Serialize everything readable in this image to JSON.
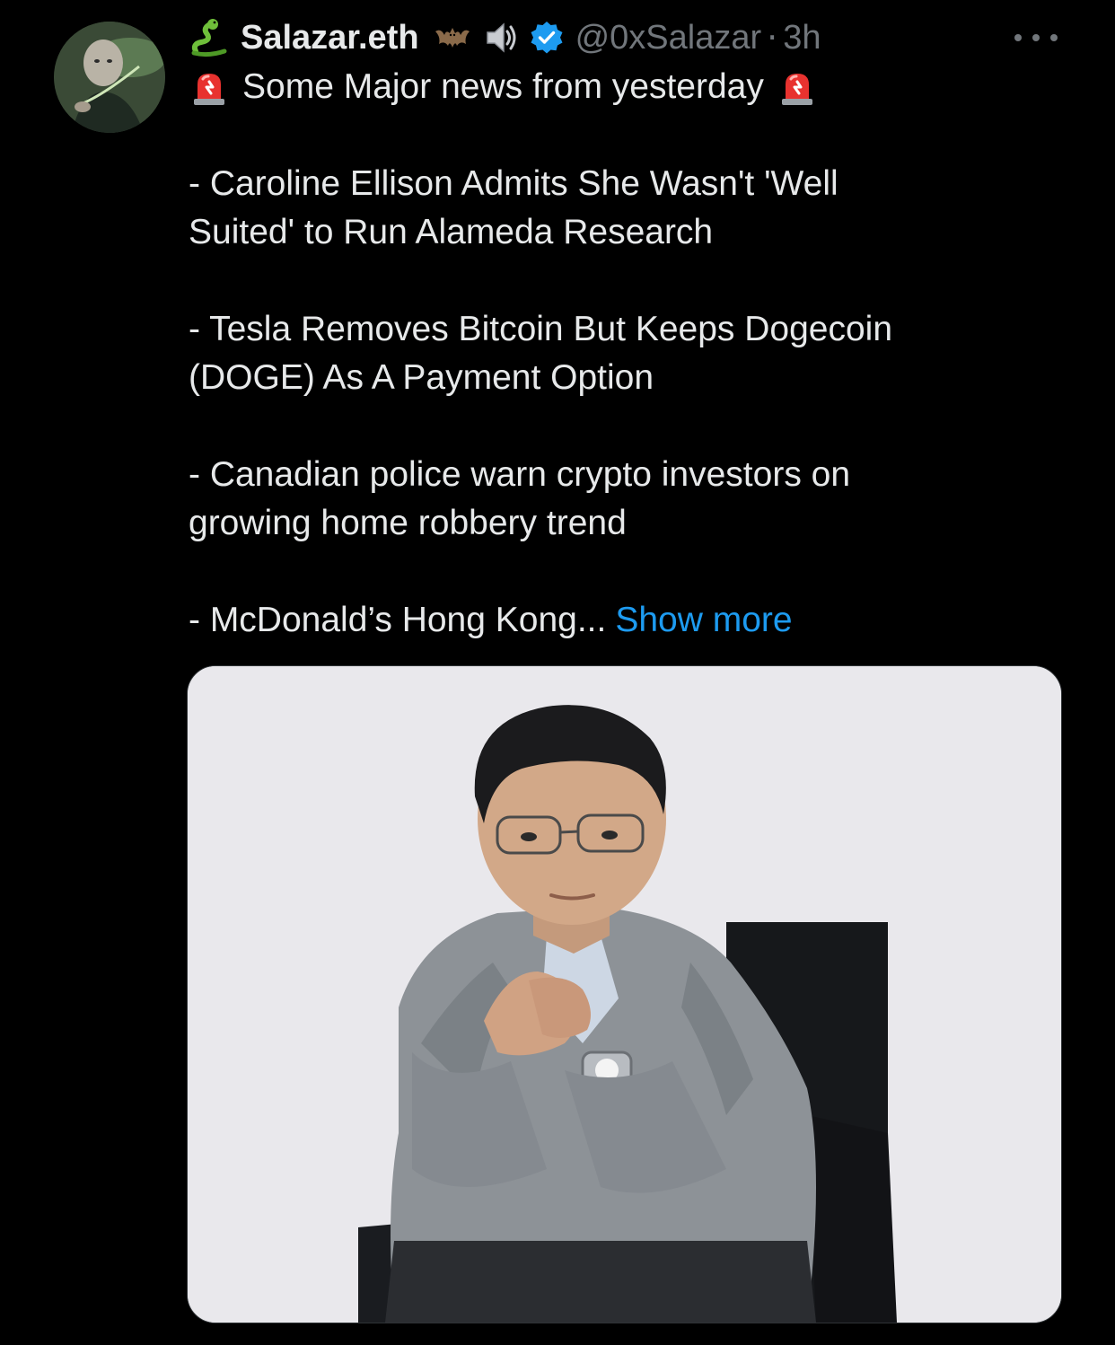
{
  "tweet": {
    "author": {
      "name_emoji": "snake-emoji",
      "display_name": "Salazar.eth",
      "badge_emojis": [
        "bat-emoji",
        "speaker-emoji"
      ],
      "verified": true,
      "handle": "@0xSalazar",
      "separator": "·",
      "time": "3h"
    },
    "headline_emoji": "rotating-light-emoji",
    "headline": "Some Major news from yesterday",
    "lines": [
      "- Caroline Ellison Admits She Wasn't 'Well",
      "Suited' to Run Alameda Research",
      "- Tesla Removes Bitcoin But Keeps Dogecoin",
      "(DOGE) As A Payment Option",
      "- Canadian police warn crypto investors on",
      "growing home robbery trend",
      "- McDonald’s Hong Kong..."
    ],
    "show_more": "Show more",
    "media": {
      "type": "photo",
      "subject": "man-in-grey-suit-seated-in-chair"
    }
  },
  "colors": {
    "background": "#000000",
    "text": "#e7e9ea",
    "muted": "#71767b",
    "link": "#1d9bf0",
    "verified": "#1d9bf0"
  }
}
